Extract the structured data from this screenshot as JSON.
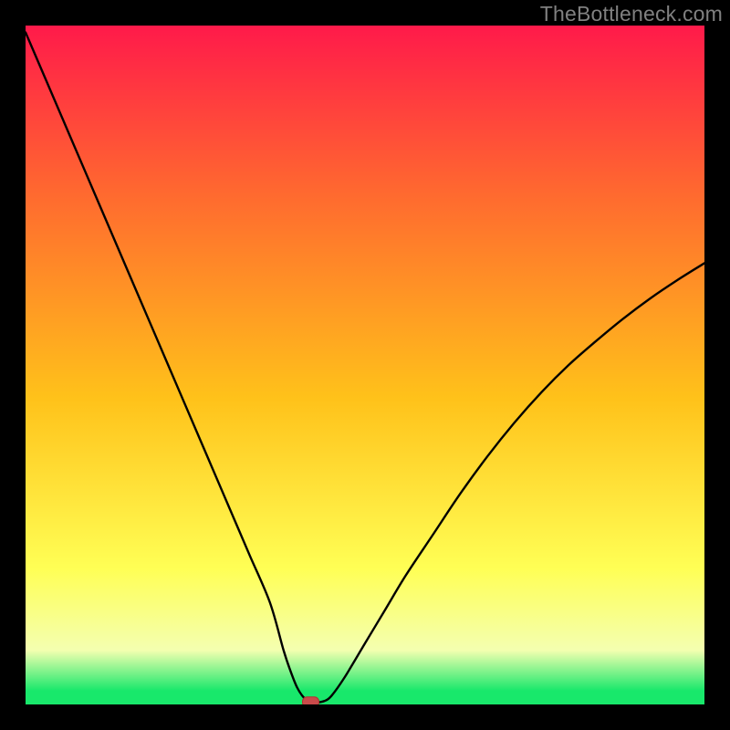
{
  "watermark": "TheBottleneck.com",
  "colors": {
    "top": "#ff1a4a",
    "upper": "#ff6a2f",
    "mid": "#ffc21a",
    "lower": "#ffff55",
    "pale": "#f4ffb0",
    "green": "#18e86b",
    "marker_fill": "#c94a4a",
    "marker_stroke": "#b23232",
    "curve": "#000000",
    "frame": "#000000"
  },
  "chart_data": {
    "type": "line",
    "title": "",
    "xlabel": "",
    "ylabel": "",
    "xlim": [
      0,
      100
    ],
    "ylim": [
      0,
      100
    ],
    "series": [
      {
        "name": "bottleneck-curve",
        "x": [
          0,
          3,
          6,
          9,
          12,
          15,
          18,
          21,
          24,
          27,
          30,
          33,
          36,
          38,
          39,
          40,
          41,
          42,
          43,
          44,
          45,
          47,
          50,
          53,
          56,
          60,
          64,
          68,
          72,
          76,
          80,
          84,
          88,
          92,
          96,
          100
        ],
        "values": [
          99,
          92,
          85,
          78,
          71,
          64,
          57,
          50,
          43,
          36,
          29,
          22,
          15,
          8,
          5,
          2.5,
          1,
          0.3,
          0.3,
          0.5,
          1.2,
          4,
          9,
          14,
          19,
          25,
          31,
          36.5,
          41.5,
          46,
          50,
          53.5,
          56.8,
          59.8,
          62.5,
          65
        ]
      }
    ],
    "flat_bottom": {
      "x_start": 40,
      "x_end": 44,
      "y": 0.3
    },
    "marker": {
      "x": 42,
      "y": 0.3
    },
    "legend": null,
    "grid": false
  }
}
